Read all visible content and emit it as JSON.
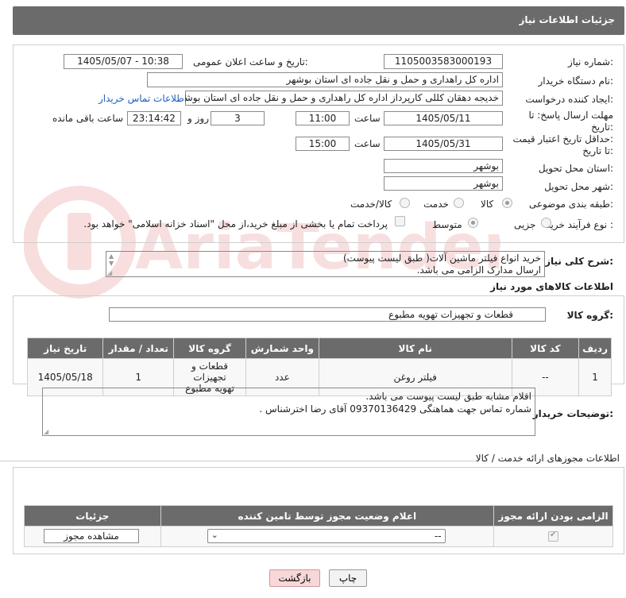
{
  "header": {
    "title": "جزئیات اطلاعات نیاز"
  },
  "fields": {
    "need_number_label": "شماره نیاز:",
    "need_number": "1105003583000193",
    "announce_label": "تاریخ و ساعت اعلان عمومی:",
    "announce_value": "1405/05/07 - 10:38",
    "buyer_org_label": "نام دستگاه خریدار:",
    "buyer_org": "اداره کل راهداری و حمل و نقل جاده ای استان بوشهر",
    "requester_label": "ایجاد کننده درخواست:",
    "requester": "خدیجه دهقان کللی کارپرداز اداره کل راهداری و حمل و نقل جاده ای استان بوشهر",
    "buyer_contact_link": "اطلاعات تماس خریدار",
    "reply_deadline_label_1": "مهلت ارسال پاسخ: تا",
    "reply_deadline_label_2": "تاریخ:",
    "reply_date": "1405/05/11",
    "time_label": "ساعت",
    "reply_time": "11:00",
    "days_value": "3",
    "days_label": "روز و",
    "remaining_time": "23:14:42",
    "remaining_label": "ساعت باقی مانده",
    "price_validity_label_1": "حداقل تاریخ اعتبار قیمت:",
    "price_validity_label_2": "تا تاریخ:",
    "validity_date": "1405/05/31",
    "validity_time": "15:00",
    "province_label": "استان محل تحویل:",
    "province": "بوشهر",
    "city_label": "شهر محل تحویل:",
    "city": "بوشهر",
    "category_label": "طبقه بندی موضوعی:",
    "category_options": [
      "کالا",
      "خدمت",
      "کالا/خدمت"
    ],
    "purchase_type_label": "نوع فرآیند خرید :",
    "purchase_options": [
      "جزیی",
      "متوسط"
    ],
    "payment_note": "پرداخت تمام یا بخشی از مبلغ خرید،از محل \"اسناد خزانه اسلامی\" خواهد بود."
  },
  "description": {
    "label": "شرح کلی نیاز:",
    "line1": "خرید انواع فیلتر ماشین آلات( طبق لیست پیوست)",
    "line2": "ارسال مدارک الزامی می باشد."
  },
  "goods": {
    "section_title": "اطلاعات کالاهای مورد نیاز",
    "group_label": "گروه کالا:",
    "group_value": "قطعات و تجهیزات تهویه مطبوع",
    "columns": [
      "ردیف",
      "کد کالا",
      "نام کالا",
      "واحد شمارش",
      "گروه کالا",
      "تعداد / مقدار",
      "تاریخ نیاز"
    ],
    "rows": [
      {
        "row": "1",
        "code": "--",
        "name": "فیلتر روغن",
        "unit": "عدد",
        "group_line1": "قطعات و تجهیزات",
        "group_line2": "تهویه مطبوع",
        "qty": "1",
        "date": "1405/05/18"
      }
    ]
  },
  "buyer_notes": {
    "label": "توضیحات خریدار:",
    "line1": "اقلام مشابه طبق لیست پیوست می باشد.",
    "line2": "شماره تماس جهت هماهنگی 09370136429 آقای رضا اخترشناس ."
  },
  "permits": {
    "section_title": "اطلاعات مجوزهای ارائه خدمت / کالا",
    "columns": [
      "الزامی بودن ارائه مجوز",
      "اعلام وضعیت مجوز توسط تامین کننده",
      "جزئیات"
    ],
    "select_value": "--",
    "view_button": "مشاهده مجوز"
  },
  "actions": {
    "print": "چاپ",
    "back": "بازگشت"
  },
  "watermark": {
    "text": "AriaTender.neT"
  },
  "colors": {
    "header_bg": "#6b6b6b",
    "link": "#1f5fbf",
    "back_btn_bg": "#f7d7d7"
  }
}
